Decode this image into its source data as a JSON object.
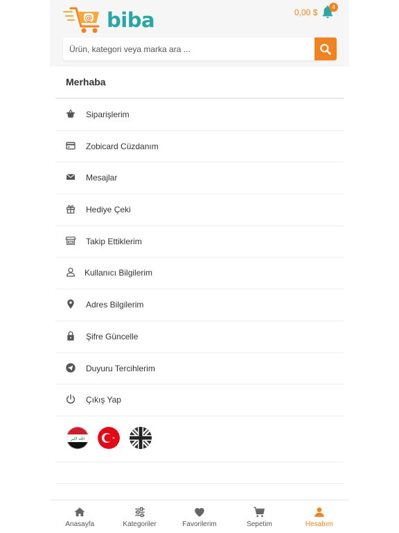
{
  "header": {
    "brand": "biba",
    "cart_total": "0,00 $",
    "notification_count": "4",
    "accent_color": "#f08321",
    "brand_color": "#2aa7a5"
  },
  "search": {
    "placeholder": "Ürün, kategori veya marka ara ...",
    "value": ""
  },
  "account": {
    "greeting": "Merhaba",
    "menu": [
      {
        "label": "Siparişlerim",
        "icon": "basket-icon"
      },
      {
        "label": "Zobicard Cüzdanım",
        "icon": "credit-card-icon"
      },
      {
        "label": "Mesajlar",
        "icon": "envelope-icon"
      },
      {
        "label": "Hediye Çeki",
        "icon": "gift-icon"
      },
      {
        "label": "Takip Ettiklerim",
        "icon": "store-icon"
      },
      {
        "label": "Kullanıcı Bilgilerim",
        "icon": "user-icon"
      },
      {
        "label": "Adres Bilgilerim",
        "icon": "location-pin-icon"
      },
      {
        "label": "Şifre Güncelle",
        "icon": "lock-icon"
      },
      {
        "label": "Duyuru Tercihlerim",
        "icon": "send-icon"
      },
      {
        "label": "Çıkış Yap",
        "icon": "power-icon"
      }
    ],
    "languages": [
      {
        "icon": "iraq-flag-icon"
      },
      {
        "icon": "turkey-flag-icon"
      },
      {
        "icon": "uk-flag-icon"
      }
    ]
  },
  "bottom_nav": {
    "items": [
      {
        "label": "Anasayfa",
        "icon": "home-icon"
      },
      {
        "label": "Kategoriler",
        "icon": "sliders-icon"
      },
      {
        "label": "Favorilerim",
        "icon": "heart-icon"
      },
      {
        "label": "Sepetim",
        "icon": "cart-icon"
      },
      {
        "label": "Hesabım",
        "icon": "user-icon",
        "active": true
      }
    ]
  }
}
